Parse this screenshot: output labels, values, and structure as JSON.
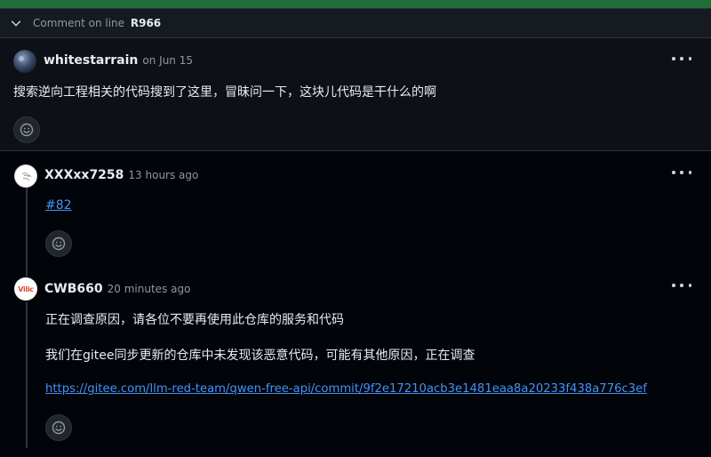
{
  "thread": {
    "header_prefix": "Comment on line",
    "header_line": "R966"
  },
  "comments": [
    {
      "author": "whitestarrain",
      "timestamp": "on Jun 15",
      "body": "搜索逆向工程相关的代码搜到了这里，冒昧问一下，这块儿代码是干什么的啊"
    },
    {
      "author": "XXXxx7258",
      "timestamp": "13 hours ago",
      "body_link": "#82"
    },
    {
      "author": "CWB660",
      "timestamp": "20 minutes ago",
      "paragraph_1": "正在调查原因，请各位不要再使用此仓库的服务和代码",
      "paragraph_2": "我们在gitee同步更新的仓库中未发现该恶意代码，可能有其他原因，正在调查",
      "link": "https://gitee.com/llm-red-team/qwen-free-api/commit/9f2e17210acb3e1481eaa8a20233f438a776c3ef",
      "avatar_text": "Vilic"
    }
  ],
  "icons": {
    "collapse": "chevron-down-icon",
    "options": "kebab-horizontal-icon",
    "reaction": "smiley-icon"
  },
  "colors": {
    "link": "#4493f8",
    "muted": "#9198a1",
    "text": "#e6edf3",
    "border": "#30363d",
    "diff_added": "#1f6f3a"
  }
}
